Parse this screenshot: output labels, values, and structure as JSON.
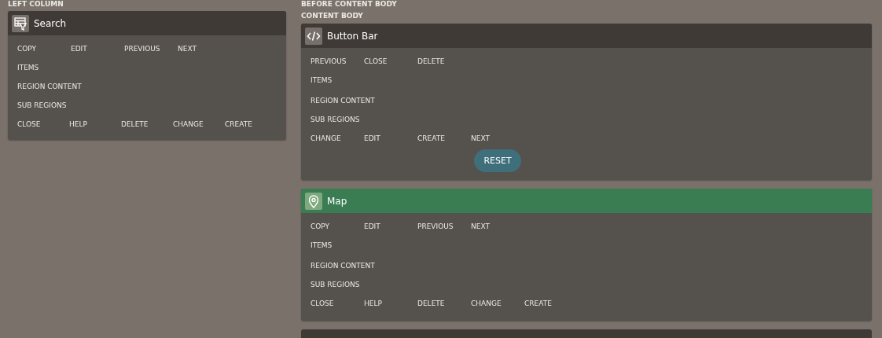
{
  "columns": [
    {
      "label": "LEFT COLUMN",
      "sections": [
        {
          "regions": [
            {
              "title": "Search",
              "kind": "search",
              "selected": false,
              "top_buttons": [
                "COPY",
                "EDIT",
                "PREVIOUS",
                "NEXT"
              ],
              "slots": [
                "ITEMS",
                "REGION CONTENT",
                "SUB REGIONS"
              ],
              "bottom_buttons": [
                "CLOSE",
                "HELP",
                "DELETE",
                "CHANGE",
                "CREATE"
              ]
            }
          ]
        }
      ]
    },
    {
      "label": "BEFORE CONTENT BODY",
      "sections": [
        {
          "label": "CONTENT BODY",
          "regions": [
            {
              "title": "Button Bar",
              "kind": "static",
              "selected": false,
              "top_buttons": [
                "PREVIOUS",
                "CLOSE",
                "DELETE"
              ],
              "slots": [
                "ITEMS",
                "REGION CONTENT",
                "SUB REGIONS"
              ],
              "bottom_buttons": [
                "CHANGE",
                "EDIT",
                "CREATE",
                "NEXT"
              ],
              "extra_button": "RESET"
            },
            {
              "title": "Map",
              "kind": "map",
              "selected": true,
              "top_buttons": [
                "COPY",
                "EDIT",
                "PREVIOUS",
                "NEXT"
              ],
              "slots": [
                "ITEMS",
                "REGION CONTENT",
                "SUB REGIONS"
              ],
              "bottom_buttons": [
                "CLOSE",
                "HELP",
                "DELETE",
                "CHANGE",
                "CREATE"
              ]
            }
          ]
        }
      ]
    }
  ]
}
